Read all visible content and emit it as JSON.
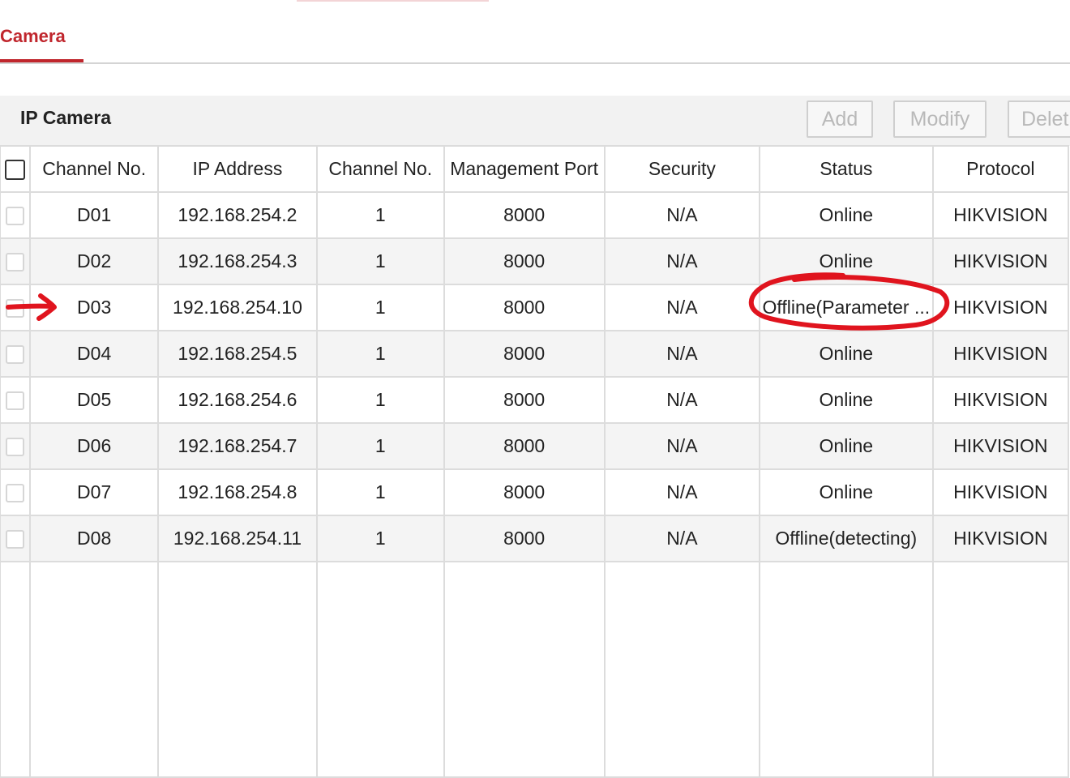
{
  "tabs": [
    {
      "label": "Camera",
      "active": true
    }
  ],
  "section": {
    "title": "IP Camera"
  },
  "toolbar": {
    "add_label": "Add",
    "modify_label": "Modify",
    "delete_label": "Delet"
  },
  "table": {
    "columns": [
      "Channel No.",
      "IP Address",
      "Channel No.",
      "Management Port",
      "Security",
      "Status",
      "Protocol"
    ],
    "rows": [
      {
        "channel": "D01",
        "ip": "192.168.254.2",
        "ch_no": "1",
        "port": "8000",
        "security": "N/A",
        "status": "Online",
        "protocol": "HIKVISION"
      },
      {
        "channel": "D02",
        "ip": "192.168.254.3",
        "ch_no": "1",
        "port": "8000",
        "security": "N/A",
        "status": "Online",
        "protocol": "HIKVISION"
      },
      {
        "channel": "D03",
        "ip": "192.168.254.10",
        "ch_no": "1",
        "port": "8000",
        "security": "N/A",
        "status": "Offline(Parameter ...",
        "protocol": "HIKVISION"
      },
      {
        "channel": "D04",
        "ip": "192.168.254.5",
        "ch_no": "1",
        "port": "8000",
        "security": "N/A",
        "status": "Online",
        "protocol": "HIKVISION"
      },
      {
        "channel": "D05",
        "ip": "192.168.254.6",
        "ch_no": "1",
        "port": "8000",
        "security": "N/A",
        "status": "Online",
        "protocol": "HIKVISION"
      },
      {
        "channel": "D06",
        "ip": "192.168.254.7",
        "ch_no": "1",
        "port": "8000",
        "security": "N/A",
        "status": "Online",
        "protocol": "HIKVISION"
      },
      {
        "channel": "D07",
        "ip": "192.168.254.8",
        "ch_no": "1",
        "port": "8000",
        "security": "N/A",
        "status": "Online",
        "protocol": "HIKVISION"
      },
      {
        "channel": "D08",
        "ip": "192.168.254.11",
        "ch_no": "1",
        "port": "8000",
        "security": "N/A",
        "status": "Offline(detecting)",
        "protocol": "HIKVISION"
      }
    ]
  },
  "colors": {
    "accent": "#c0262d",
    "annotation": "#e0141e",
    "row_alt": "#f4f4f4",
    "section_bg": "#f2f2f2"
  },
  "annotations": [
    "arrow-pointing-to-D03-row",
    "circle-around-D03-status"
  ]
}
